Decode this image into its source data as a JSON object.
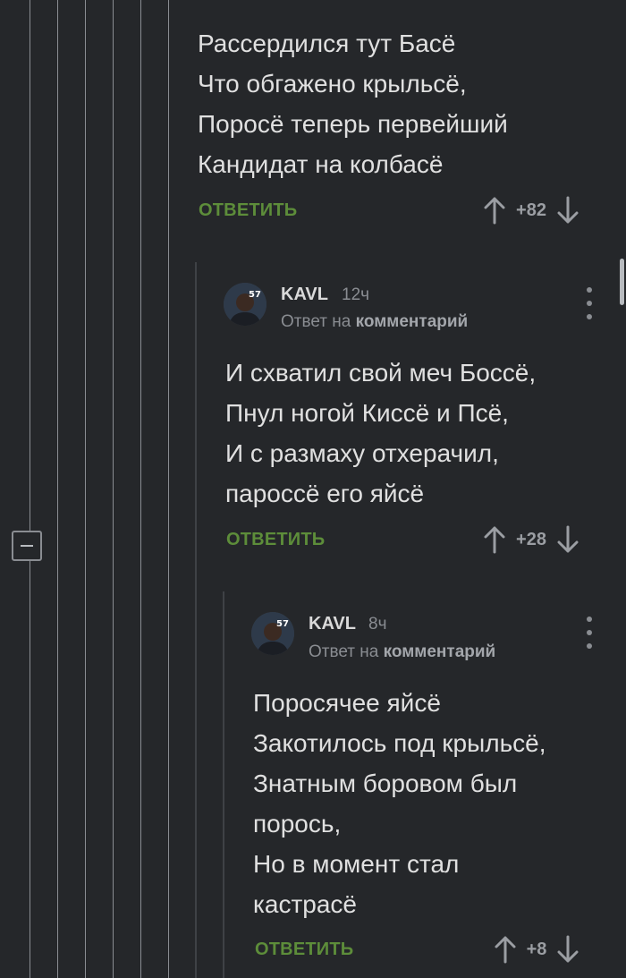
{
  "comments": [
    {
      "text": "Рассердился тут Басё\nЧто обгажено крыльсё,\nПоросё теперь первейший\nКандидат на колбасё",
      "reply_label": "ОТВЕТИТЬ",
      "score": "+82"
    },
    {
      "author": "KAVL",
      "time": "12ч",
      "reply_to_prefix": "Ответ на",
      "reply_to_link": "комментарий",
      "text": "И схватил свой меч Боссё,\nПнул ногой Киссё и Псё,\nИ с размаху отхерачил,\nпароссё его яйсё",
      "reply_label": "ОТВЕТИТЬ",
      "score": "+28"
    },
    {
      "author": "KAVL",
      "time": "8ч",
      "reply_to_prefix": "Ответ на",
      "reply_to_link": "комментарий",
      "text": "Поросячее яйсё\nЗакотилось под крыльсё,\nЗнатным боровом был\nпорось,\nНо в момент стал\nкастрасё",
      "reply_label": "ОТВЕТИТЬ",
      "score": "+8"
    }
  ],
  "icons": {
    "upvote": "arrow-up-icon",
    "downvote": "arrow-down-icon",
    "more": "more-vertical-icon",
    "collapse": "minus-icon"
  },
  "colors": {
    "background": "#25272a",
    "reply_green": "#5d8d3a",
    "muted": "#8a8d92"
  }
}
